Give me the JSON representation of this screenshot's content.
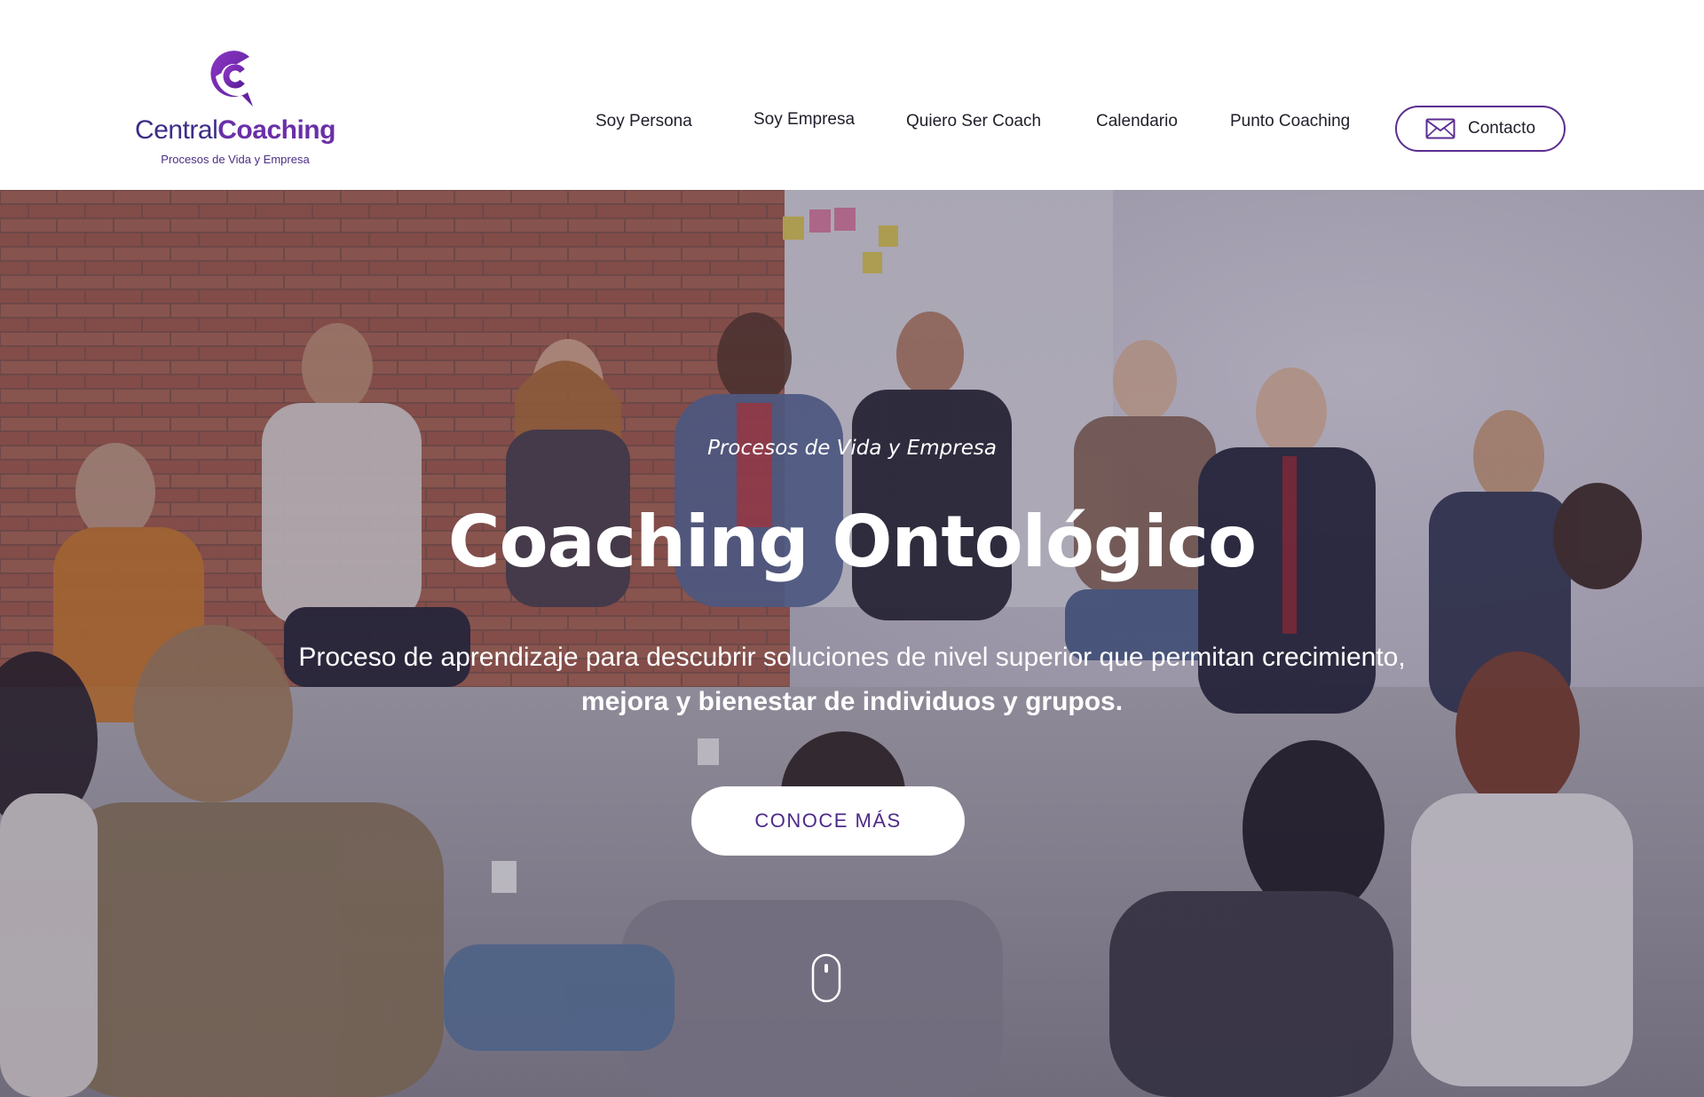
{
  "brand": {
    "name_light": "Central",
    "name_bold": "Coaching",
    "tagline": "Procesos de Vida y Empresa",
    "colors": {
      "primary": "#6a2fa8",
      "dark": "#3a2e88"
    }
  },
  "nav": {
    "items": [
      {
        "label": "Soy Persona"
      },
      {
        "label": "Soy Empresa"
      },
      {
        "label": "Quiero Ser Coach"
      },
      {
        "label": "Calendario"
      },
      {
        "label": "Punto Coaching"
      }
    ],
    "contact": {
      "label": "Contacto",
      "icon": "envelope-icon"
    }
  },
  "hero": {
    "pretitle": "Procesos de Vida y Empresa",
    "title": "Coaching Ontológico",
    "desc_line1": "Proceso de aprendizaje para descubrir soluciones de nivel superior que permitan crecimiento,",
    "desc_line2": "mejora y bienestar de individuos y grupos.",
    "cta": "CONOCE MÁS",
    "scroll_icon": "mouse-scroll-icon"
  }
}
